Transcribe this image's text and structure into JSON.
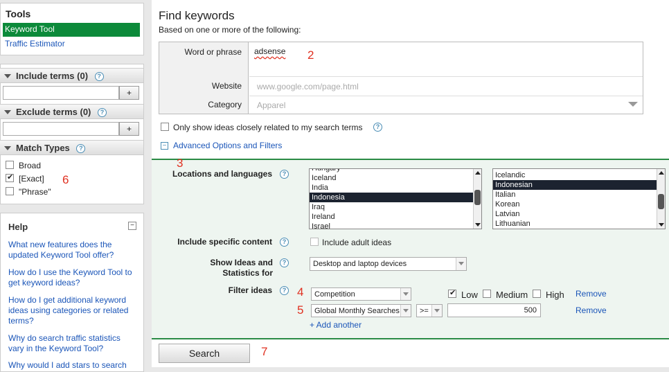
{
  "tools": {
    "title": "Tools",
    "active": "Keyword Tool",
    "link": "Traffic Estimator"
  },
  "sidebar": {
    "include_terms": "Include terms (0)",
    "exclude_terms": "Exclude terms (0)",
    "match_types": "Match Types",
    "add_label": "+",
    "help_mark": "?",
    "match_options": [
      {
        "label": "Broad",
        "checked": false
      },
      {
        "label": "[Exact]",
        "checked": true
      },
      {
        "label": "\"Phrase\"",
        "checked": false
      }
    ],
    "help_title": "Help",
    "help_collapse": "−",
    "help_links": [
      "What new features does the updated Keyword Tool offer?",
      "How do I use the Keyword Tool to get keyword ideas?",
      "How do I get additional keyword ideas using categories or related terms?",
      "Why do search traffic statistics vary in the Keyword Tool?",
      "Why would I add stars to search"
    ]
  },
  "annotations": {
    "n2": "2",
    "n3": "3",
    "n4": "4",
    "n5": "5",
    "n6": "6",
    "n7": "7"
  },
  "main": {
    "title": "Find keywords",
    "subtitle": "Based on one or more of the following:",
    "word_label": "Word or phrase",
    "word_value": "adsense",
    "website_label": "Website",
    "website_placeholder": "www.google.com/page.html",
    "category_label": "Category",
    "category_placeholder": "Apparel",
    "only_show": "Only show ideas closely related to my search terms",
    "advanced": "Advanced Options and Filters",
    "advanced_icon": "−",
    "locations_label": "Locations and languages",
    "countries": [
      "Hungary",
      "Iceland",
      "India",
      "Indonesia",
      "Iraq",
      "Ireland",
      "Israel"
    ],
    "country_selected": "Indonesia",
    "languages": [
      "Icelandic",
      "Indonesian",
      "Italian",
      "Korean",
      "Latvian",
      "Lithuanian"
    ],
    "language_selected": "Indonesian",
    "specific_content_label": "Include specific content",
    "adult_label": "Include adult ideas",
    "show_ideas_label": "Show Ideas and Statistics for",
    "device_value": "Desktop and laptop devices",
    "filter_label": "Filter ideas",
    "filter1_field": "Competition",
    "comp_low": "Low",
    "comp_medium": "Medium",
    "comp_high": "High",
    "filter2_field": "Global Monthly Searches",
    "filter2_op": ">=",
    "filter2_value": "500",
    "remove": "Remove",
    "add_another": "+ Add another",
    "search_button": "Search"
  }
}
